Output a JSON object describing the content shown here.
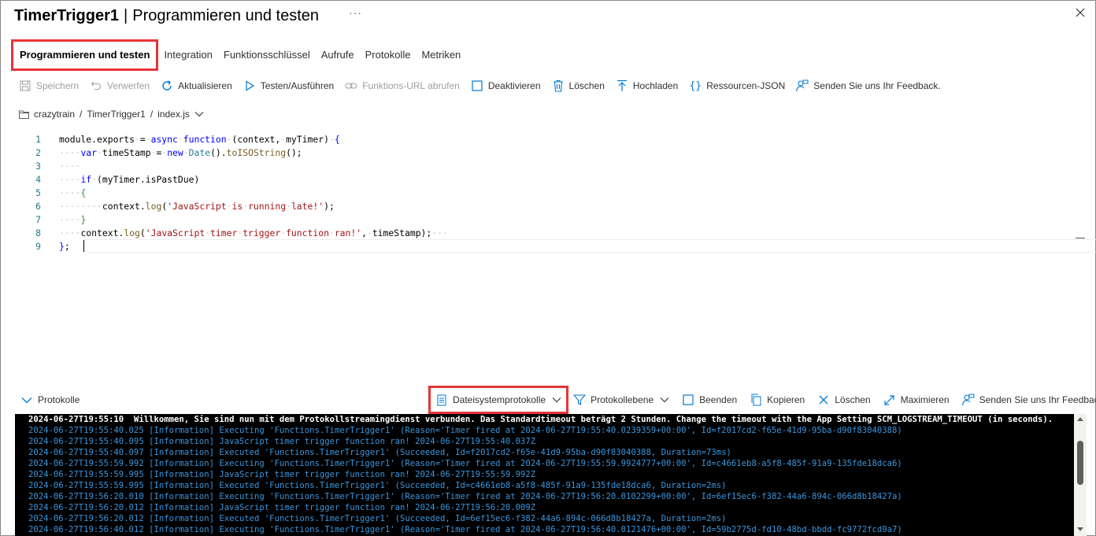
{
  "header": {
    "title": "TimerTrigger1",
    "separator": "|",
    "subtitle": "Programmieren und testen",
    "more": "···"
  },
  "tabs": [
    {
      "label": "Programmieren und testen",
      "active": true
    },
    {
      "label": "Integration"
    },
    {
      "label": "Funktionsschlüssel"
    },
    {
      "label": "Aufrufe"
    },
    {
      "label": "Protokolle"
    },
    {
      "label": "Metriken"
    }
  ],
  "toolbar": {
    "save": "Speichern",
    "discard": "Verwerfen",
    "refresh": "Aktualisieren",
    "test_run": "Testen/Ausführen",
    "get_url": "Funktions-URL abrufen",
    "disable": "Deaktivieren",
    "delete": "Löschen",
    "upload": "Hochladen",
    "resource_json": "Ressourcen-JSON",
    "feedback": "Senden Sie uns Ihr Feedback."
  },
  "breadcrumb": {
    "app": "crazytrain",
    "sep1": "/",
    "function": "TimerTrigger1",
    "sep2": "/",
    "file": "index.js"
  },
  "editor": {
    "line_numbers": [
      "1",
      "2",
      "3",
      "4",
      "5",
      "6",
      "7",
      "8",
      "9"
    ]
  },
  "logs": {
    "toggle_label": "Protokolle",
    "source_dropdown": "Dateisystemprotokolle",
    "level_dropdown": "Protokollebene",
    "stop": "Beenden",
    "copy": "Kopieren",
    "clear": "Löschen",
    "maximize": "Maximieren",
    "feedback": "Senden Sie uns Ihr Feedback.",
    "lines": [
      "2024-06-27T19:55:10  Willkommen, Sie sind nun mit dem Protokollstreamingdienst verbunden. Das Standardtimeout beträgt 2 Stunden. Change the timeout with the App Setting SCM_LOGSTREAM_TIMEOUT (in seconds).",
      "2024-06-27T19:55:40.025 [Information] Executing 'Functions.TimerTrigger1' (Reason='Timer fired at 2024-06-27T19:55:40.0239359+00:00', Id=f2017cd2-f65e-41d9-95ba-d90f83040388)",
      "2024-06-27T19:55:40.095 [Information] JavaScript timer trigger function ran! 2024-06-27T19:55:40.037Z",
      "2024-06-27T19:55:40.097 [Information] Executed 'Functions.TimerTrigger1' (Succeeded, Id=f2017cd2-f65e-41d9-95ba-d90f83040388, Duration=73ms)",
      "2024-06-27T19:55:59.992 [Information] Executing 'Functions.TimerTrigger1' (Reason='Timer fired at 2024-06-27T19:55:59.9924777+00:00', Id=c4661eb8-a5f8-485f-91a9-135fde18dca6)",
      "2024-06-27T19:55:59.995 [Information] JavaScript timer trigger function ran! 2024-06-27T19:55:59.992Z",
      "2024-06-27T19:55:59.995 [Information] Executed 'Functions.TimerTrigger1' (Succeeded, Id=c4661eb8-a5f8-485f-91a9-135fde18dca6, Duration=2ms)",
      "2024-06-27T19:56:20.010 [Information] Executing 'Functions.TimerTrigger1' (Reason='Timer fired at 2024-06-27T19:56:20.0102299+00:00', Id=6ef15ec6-f382-44a6-894c-066d8b18427a)",
      "2024-06-27T19:56:20.012 [Information] JavaScript timer trigger function ran! 2024-06-27T19:56:20.009Z",
      "2024-06-27T19:56:20.012 [Information] Executed 'Functions.TimerTrigger1' (Succeeded, Id=6ef15ec6-f382-44a6-894c-066d8b18427a, Duration=2ms)",
      "2024-06-27T19:56:40.012 [Information] Executing 'Functions.TimerTrigger1' (Reason='Timer fired at 2024-06-27T19:56:40.0121476+00:00', Id=59b2775d-fd10-48bd-bbdd-fc9772fcd9a7)"
    ]
  },
  "colors": {
    "highlight_box": "#e8343a",
    "accent": "#0078d4",
    "console_bg": "#000000",
    "console_info": "#3a96dd"
  }
}
